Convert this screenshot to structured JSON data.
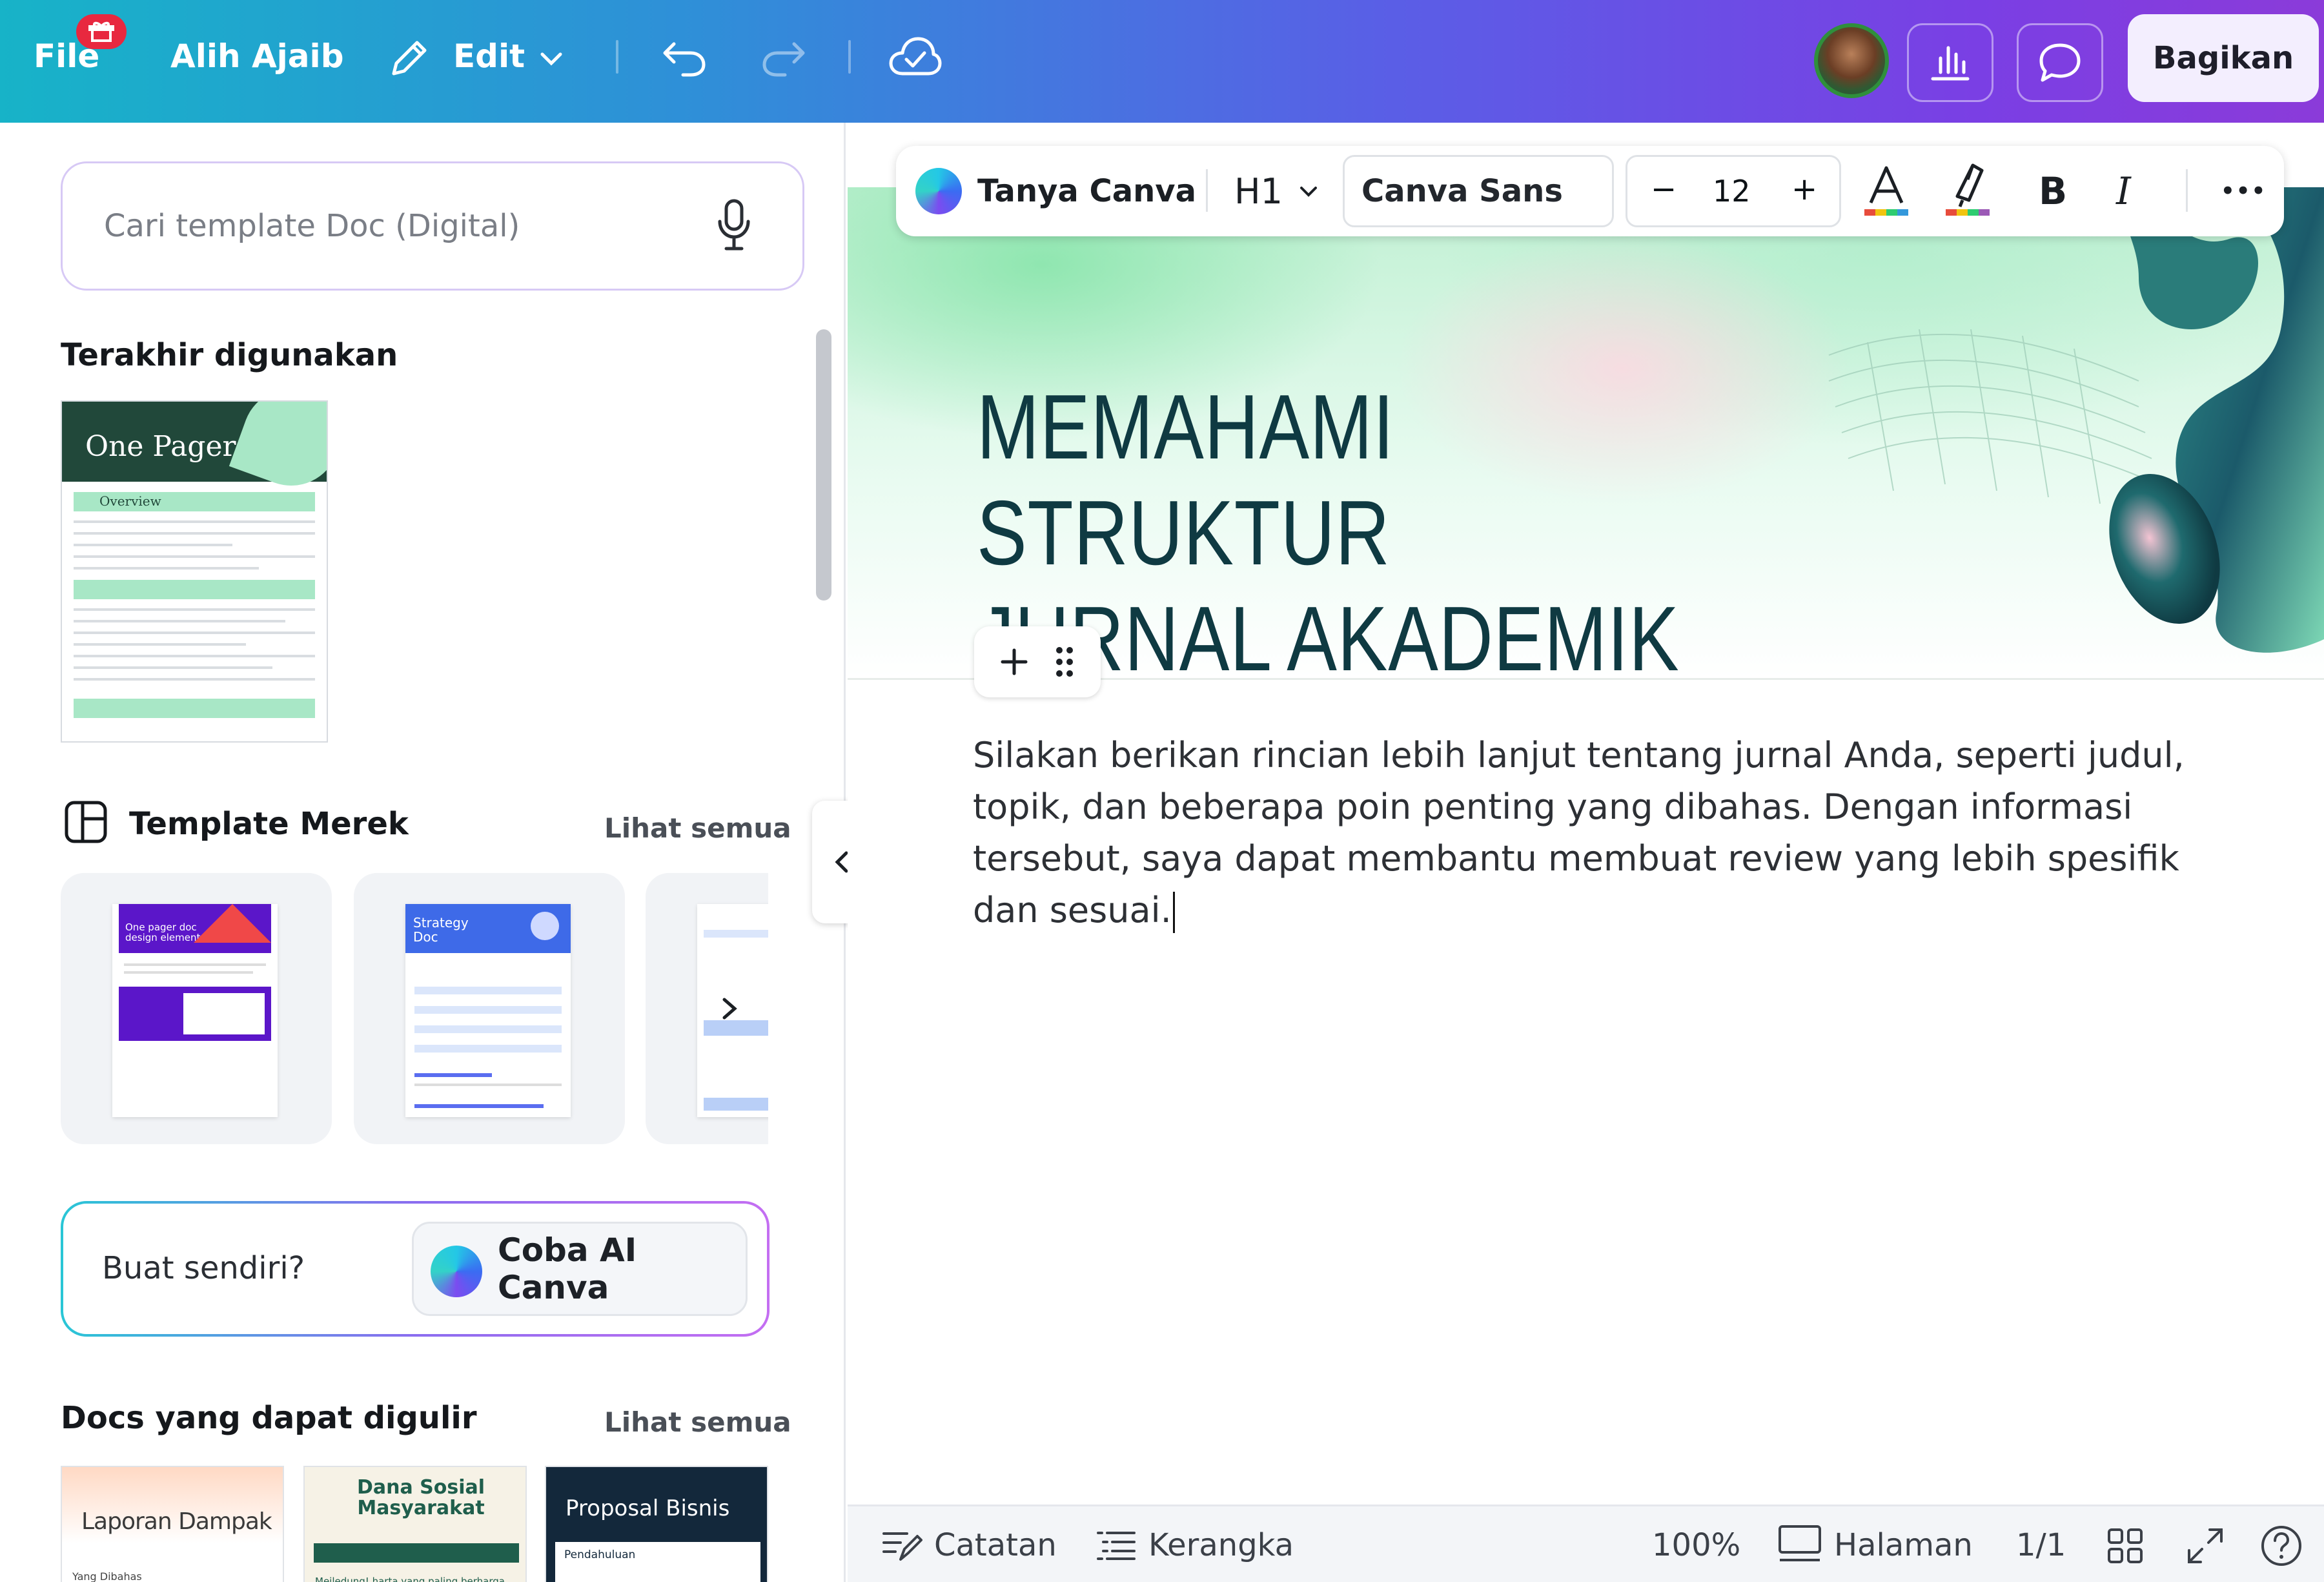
{
  "topbar": {
    "file_label": "File",
    "magic_switch_label": "Alih Ajaib",
    "edit_label": "Edit",
    "share_label": "Bagikan"
  },
  "left_panel": {
    "search_placeholder": "Cari template Doc (Digital)",
    "recent_title": "Terakhir digunakan",
    "recent_template_title": "One Pager",
    "recent_template_section": "Overview",
    "brand_templates_title": "Template Merek",
    "brand_see_all": "Lihat semua",
    "brand_card_1_title": "One pager doc design elements",
    "brand_card_2_title": "Strategy Doc",
    "ai_question": "Buat sendiri?",
    "ai_button": "Coba AI Canva",
    "scrollable_docs_title": "Docs yang dapat digulir",
    "scrollable_see_all": "Lihat semua",
    "scroll_cards": [
      {
        "title": "Laporan Dampak",
        "subtitle": "Yang Dibahas"
      },
      {
        "title": "Dana Sosial Masyarakat",
        "subtitle": "Meiledung! harta yang paling berharga"
      },
      {
        "title": "Proposal Bisnis",
        "subtitle": "Pendahuluan"
      }
    ]
  },
  "toolbar": {
    "ask_canva": "Tanya Canva",
    "heading": "H1",
    "font_name": "Canva Sans",
    "font_size": "12",
    "minus": "−",
    "plus": "+",
    "bold": "B",
    "italic": "I",
    "more": "•••"
  },
  "document": {
    "title_line_1": "MEMAHAMI STRUKTUR",
    "title_line_2": "JURNAL AKADEMIK",
    "body": "Silakan berikan rincian lebih lanjut tentang jurnal Anda, seperti judul, topik, dan beberapa poin penting yang dibahas. Dengan informasi tersebut, saya dapat membantu membuat review yang lebih spesifik dan sesuai."
  },
  "footer": {
    "notes_label": "Catatan",
    "outline_label": "Kerangka",
    "zoom": "100%",
    "pages_label": "Halaman",
    "page_count": "1/1"
  },
  "colors": {
    "brand_gradient_start": "#17b3c8",
    "brand_gradient_end": "#8b3bd9",
    "title_color": "#0f3a42",
    "badge_red": "#e8283f"
  }
}
